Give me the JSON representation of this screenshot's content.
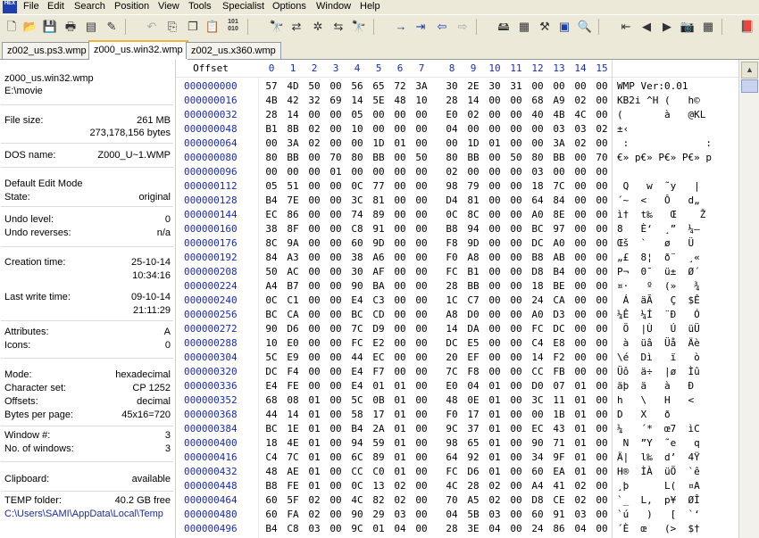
{
  "menu": [
    "File",
    "Edit",
    "Search",
    "Position",
    "View",
    "Tools",
    "Specialist",
    "Options",
    "Window",
    "Help"
  ],
  "app_icon_text": "HEX",
  "toolbar_icons": [
    "new-file-icon",
    "open-folder-icon",
    "save-icon",
    "print-icon",
    "properties-icon",
    "edit-icon",
    "undo-icon",
    "copy-icon",
    "copy-block-icon",
    "paste-icon",
    "hex-paste-icon",
    "search-icon",
    "replace-icon",
    "search-hex-icon",
    "replace-hex-icon",
    "find-next-icon",
    "goto-offset-icon",
    "goto-sector-icon",
    "back-icon",
    "forward-icon",
    "disk-icon",
    "ram-icon",
    "tools-icon",
    "calculator-icon",
    "zoom-icon",
    "first-icon",
    "prev-icon",
    "next-icon",
    "camera-icon",
    "table-icon",
    "book-icon"
  ],
  "tabs": [
    "z002_us.ps3.wmp",
    "z000_us.win32.wmp",
    "z002_us.x360.wmp"
  ],
  "sidebar": {
    "filename": "z000_us.win32.wmp",
    "path": "E:\\movie",
    "file_size_label": "File size:",
    "file_size_mb": "261 MB",
    "file_size_bytes": "273,178,156 bytes",
    "dos_name_label": "DOS name:",
    "dos_name": "Z000_U~1.WMP",
    "edit_mode": "Default Edit Mode",
    "state_label": "State:",
    "state": "original",
    "undo_level_label": "Undo level:",
    "undo_level": "0",
    "undo_reverses_label": "Undo reverses:",
    "undo_reverses": "n/a",
    "creation_label": "Creation time:",
    "creation_date": "25-10-14",
    "creation_time": "10:34:16",
    "write_label": "Last write time:",
    "write_date": "09-10-14",
    "write_time": "21:11:29",
    "attributes_label": "Attributes:",
    "attributes": "A",
    "icons_label": "Icons:",
    "icons": "0",
    "mode_label": "Mode:",
    "mode": "hexadecimal",
    "charset_label": "Character set:",
    "charset": "CP 1252",
    "offsets_label": "Offsets:",
    "offsets": "decimal",
    "bpp_label": "Bytes per page:",
    "bpp": "45x16=720",
    "window_label": "Window #:",
    "window": "3",
    "nwin_label": "No. of windows:",
    "nwin": "3",
    "clipboard_label": "Clipboard:",
    "clipboard": "available",
    "temp_label": "TEMP folder:",
    "temp_free": "40.2 GB free",
    "temp_path": "C:\\Users\\SAMI\\AppData\\Local\\Temp"
  },
  "hex_header": {
    "offset_label": "Offset",
    "columns": [
      "0",
      "1",
      "2",
      "3",
      "4",
      "5",
      "6",
      "7",
      "8",
      "9",
      "10",
      "11",
      "12",
      "13",
      "14",
      "15"
    ]
  },
  "rows": [
    {
      "offset": "000000000",
      "bytes": [
        "57",
        "4D",
        "50",
        "00",
        "56",
        "65",
        "72",
        "3A",
        "30",
        "2E",
        "30",
        "31",
        "00",
        "00",
        "00",
        "00"
      ],
      "ascii": "WMP Ver:0.01"
    },
    {
      "offset": "000000016",
      "bytes": [
        "4B",
        "42",
        "32",
        "69",
        "14",
        "5E",
        "48",
        "10",
        "28",
        "14",
        "00",
        "00",
        "68",
        "A9",
        "02",
        "00"
      ],
      "ascii": "KB2i ^H (   h©"
    },
    {
      "offset": "000000032",
      "bytes": [
        "28",
        "14",
        "00",
        "00",
        "05",
        "00",
        "00",
        "00",
        "E0",
        "02",
        "00",
        "00",
        "40",
        "4B",
        "4C",
        "00"
      ],
      "ascii": "(       à   @KL"
    },
    {
      "offset": "000000048",
      "bytes": [
        "B1",
        "8B",
        "02",
        "00",
        "10",
        "00",
        "00",
        "00",
        "04",
        "00",
        "00",
        "00",
        "00",
        "03",
        "03",
        "02"
      ],
      "ascii": "±‹"
    },
    {
      "offset": "000000064",
      "bytes": [
        "00",
        "3A",
        "02",
        "00",
        "00",
        "1D",
        "01",
        "00",
        "00",
        "1D",
        "01",
        "00",
        "00",
        "3A",
        "02",
        "00"
      ],
      "ascii": " :             :"
    },
    {
      "offset": "000000080",
      "bytes": [
        "80",
        "BB",
        "00",
        "70",
        "80",
        "BB",
        "00",
        "50",
        "80",
        "BB",
        "00",
        "50",
        "80",
        "BB",
        "00",
        "70"
      ],
      "ascii": "€» p€» P€» P€» p"
    },
    {
      "offset": "000000096",
      "bytes": [
        "00",
        "00",
        "00",
        "01",
        "00",
        "00",
        "00",
        "00",
        "02",
        "00",
        "00",
        "00",
        "03",
        "00",
        "00",
        "00"
      ],
      "ascii": ""
    },
    {
      "offset": "000000112",
      "bytes": [
        "05",
        "51",
        "00",
        "00",
        "0C",
        "77",
        "00",
        "00",
        "98",
        "79",
        "00",
        "00",
        "18",
        "7C",
        "00",
        "00"
      ],
      "ascii": " Q   w  ˜y   |"
    },
    {
      "offset": "000000128",
      "bytes": [
        "B4",
        "7E",
        "00",
        "00",
        "3C",
        "81",
        "00",
        "00",
        "D4",
        "81",
        "00",
        "00",
        "64",
        "84",
        "00",
        "00"
      ],
      "ascii": "´~  <   Ô   d„"
    },
    {
      "offset": "000000144",
      "bytes": [
        "EC",
        "86",
        "00",
        "00",
        "74",
        "89",
        "00",
        "00",
        "0C",
        "8C",
        "00",
        "00",
        "A0",
        "8E",
        "00",
        "00"
      ],
      "ascii": "ì†  t‰   Œ    Ž"
    },
    {
      "offset": "000000160",
      "bytes": [
        "38",
        "8F",
        "00",
        "00",
        "C8",
        "91",
        "00",
        "00",
        "B8",
        "94",
        "00",
        "00",
        "BC",
        "97",
        "00",
        "00"
      ],
      "ascii": "8   È‘  ¸”  ¼—"
    },
    {
      "offset": "000000176",
      "bytes": [
        "8C",
        "9A",
        "00",
        "00",
        "60",
        "9D",
        "00",
        "00",
        "F8",
        "9D",
        "00",
        "00",
        "DC",
        "A0",
        "00",
        "00"
      ],
      "ascii": "Œš  `   ø   Ü"
    },
    {
      "offset": "000000192",
      "bytes": [
        "84",
        "A3",
        "00",
        "00",
        "38",
        "A6",
        "00",
        "00",
        "F0",
        "A8",
        "00",
        "00",
        "B8",
        "AB",
        "00",
        "00"
      ],
      "ascii": "„£  8¦  ð¨  ¸«"
    },
    {
      "offset": "000000208",
      "bytes": [
        "50",
        "AC",
        "00",
        "00",
        "30",
        "AF",
        "00",
        "00",
        "FC",
        "B1",
        "00",
        "00",
        "D8",
        "B4",
        "00",
        "00"
      ],
      "ascii": "P¬  0¯  ü±  Ø´"
    },
    {
      "offset": "000000224",
      "bytes": [
        "A4",
        "B7",
        "00",
        "00",
        "90",
        "BA",
        "00",
        "00",
        "28",
        "BB",
        "00",
        "00",
        "18",
        "BE",
        "00",
        "00"
      ],
      "ascii": "¤·   º  (»   ¾"
    },
    {
      "offset": "000000240",
      "bytes": [
        "0C",
        "C1",
        "00",
        "00",
        "E4",
        "C3",
        "00",
        "00",
        "1C",
        "C7",
        "00",
        "00",
        "24",
        "CA",
        "00",
        "00"
      ],
      "ascii": " Á  äÃ   Ç  $Ê"
    },
    {
      "offset": "000000256",
      "bytes": [
        "BC",
        "CA",
        "00",
        "00",
        "BC",
        "CD",
        "00",
        "00",
        "A8",
        "D0",
        "00",
        "00",
        "A0",
        "D3",
        "00",
        "00"
      ],
      "ascii": "¼Ê  ¼Í  ¨Ð   Ó"
    },
    {
      "offset": "000000272",
      "bytes": [
        "90",
        "D6",
        "00",
        "00",
        "7C",
        "D9",
        "00",
        "00",
        "14",
        "DA",
        "00",
        "00",
        "FC",
        "DC",
        "00",
        "00"
      ],
      "ascii": " Ö  |Ù   Ú  üÜ"
    },
    {
      "offset": "000000288",
      "bytes": [
        "10",
        "E0",
        "00",
        "00",
        "FC",
        "E2",
        "00",
        "00",
        "DC",
        "E5",
        "00",
        "00",
        "C4",
        "E8",
        "00",
        "00"
      ],
      "ascii": " à  üâ  Üå  Äè"
    },
    {
      "offset": "000000304",
      "bytes": [
        "5C",
        "E9",
        "00",
        "00",
        "44",
        "EC",
        "00",
        "00",
        "20",
        "EF",
        "00",
        "00",
        "14",
        "F2",
        "00",
        "00"
      ],
      "ascii": "\\é  Dì   ï   ò"
    },
    {
      "offset": "000000320",
      "bytes": [
        "DC",
        "F4",
        "00",
        "00",
        "E4",
        "F7",
        "00",
        "00",
        "7C",
        "F8",
        "00",
        "00",
        "CC",
        "FB",
        "00",
        "00"
      ],
      "ascii": "Üô  ä÷  |ø  Ìû"
    },
    {
      "offset": "000000336",
      "bytes": [
        "E4",
        "FE",
        "00",
        "00",
        "E4",
        "01",
        "01",
        "00",
        "E0",
        "04",
        "01",
        "00",
        "D0",
        "07",
        "01",
        "00"
      ],
      "ascii": "äþ  ä   à   Ð"
    },
    {
      "offset": "000000352",
      "bytes": [
        "68",
        "08",
        "01",
        "00",
        "5C",
        "0B",
        "01",
        "00",
        "48",
        "0E",
        "01",
        "00",
        "3C",
        "11",
        "01",
        "00"
      ],
      "ascii": "h   \\   H   <"
    },
    {
      "offset": "000000368",
      "bytes": [
        "44",
        "14",
        "01",
        "00",
        "58",
        "17",
        "01",
        "00",
        "F0",
        "17",
        "01",
        "00",
        "00",
        "1B",
        "01",
        "00"
      ],
      "ascii": "D   X   ð"
    },
    {
      "offset": "000000384",
      "bytes": [
        "BC",
        "1E",
        "01",
        "00",
        "B4",
        "2A",
        "01",
        "00",
        "9C",
        "37",
        "01",
        "00",
        "EC",
        "43",
        "01",
        "00"
      ],
      "ascii": "¼   ´*  œ7  ìC"
    },
    {
      "offset": "000000400",
      "bytes": [
        "18",
        "4E",
        "01",
        "00",
        "94",
        "59",
        "01",
        "00",
        "98",
        "65",
        "01",
        "00",
        "90",
        "71",
        "01",
        "00"
      ],
      "ascii": " N  ”Y  ˜e   q"
    },
    {
      "offset": "000000416",
      "bytes": [
        "C4",
        "7C",
        "01",
        "00",
        "6C",
        "89",
        "01",
        "00",
        "64",
        "92",
        "01",
        "00",
        "34",
        "9F",
        "01",
        "00"
      ],
      "ascii": "Ä|  l‰  d’  4Ÿ"
    },
    {
      "offset": "000000432",
      "bytes": [
        "48",
        "AE",
        "01",
        "00",
        "CC",
        "C0",
        "01",
        "00",
        "FC",
        "D6",
        "01",
        "00",
        "60",
        "EA",
        "01",
        "00"
      ],
      "ascii": "H®  ÌÀ  üÖ  `ê"
    },
    {
      "offset": "000000448",
      "bytes": [
        "B8",
        "FE",
        "01",
        "00",
        "0C",
        "13",
        "02",
        "00",
        "4C",
        "28",
        "02",
        "00",
        "A4",
        "41",
        "02",
        "00"
      ],
      "ascii": "¸þ      L(  ¤A"
    },
    {
      "offset": "000000464",
      "bytes": [
        "60",
        "5F",
        "02",
        "00",
        "4C",
        "82",
        "02",
        "00",
        "70",
        "A5",
        "02",
        "00",
        "D8",
        "CE",
        "02",
        "00"
      ],
      "ascii": "`_  L‚  p¥  ØÎ"
    },
    {
      "offset": "000000480",
      "bytes": [
        "60",
        "FA",
        "02",
        "00",
        "90",
        "29",
        "03",
        "00",
        "04",
        "5B",
        "03",
        "00",
        "60",
        "91",
        "03",
        "00"
      ],
      "ascii": "`ú   )   [  `‘"
    },
    {
      "offset": "000000496",
      "bytes": [
        "B4",
        "C8",
        "03",
        "00",
        "9C",
        "01",
        "04",
        "00",
        "28",
        "3E",
        "04",
        "00",
        "24",
        "86",
        "04",
        "00"
      ],
      "ascii": "´È  œ   (>  $†"
    }
  ]
}
